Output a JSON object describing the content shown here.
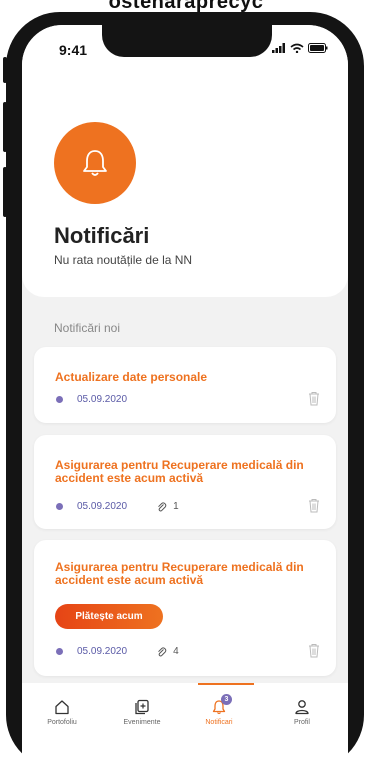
{
  "status": {
    "time": "9:41"
  },
  "header": {
    "title": "Notificări",
    "subtitle": "Nu rata noutățile de la NN"
  },
  "section": {
    "title": "Notificări noi"
  },
  "notifications": [
    {
      "title": "Actualizare date personale",
      "date": "05.09.2020",
      "attachments": ""
    },
    {
      "title": "Asigurarea pentru Recuperare medicală din accident este acum activă",
      "date": "05.09.2020",
      "attachments": "1"
    },
    {
      "title": "Asigurarea pentru Recuperare medicală din accident este acum activă",
      "date": "05.09.2020",
      "attachments": "4",
      "action": "Plătește acum"
    }
  ],
  "tabbar": {
    "items": [
      {
        "label": "Portofoliu",
        "icon": "home-icon"
      },
      {
        "label": "Evenimente",
        "icon": "documents-icon"
      },
      {
        "label": "Notificari",
        "icon": "bell-icon",
        "badge": "3",
        "active": true
      },
      {
        "label": "Profil",
        "icon": "user-icon"
      }
    ]
  },
  "colors": {
    "accent": "#ee7220",
    "purple": "#7b6fb8",
    "background": "#f2f2f2"
  }
}
